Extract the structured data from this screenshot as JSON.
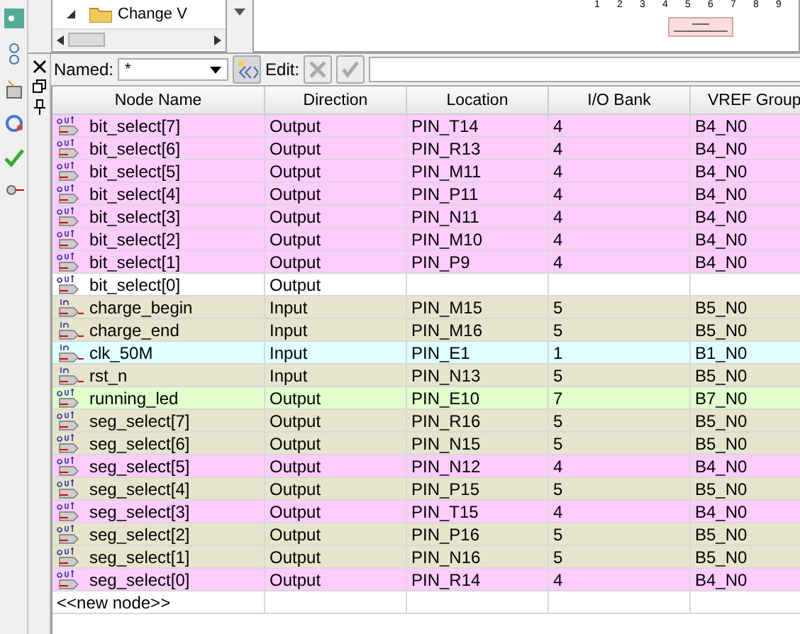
{
  "tree": {
    "item": "Change V"
  },
  "timeline": {
    "ticks": [
      "1",
      "2",
      "3",
      "4",
      "5",
      "6",
      "7",
      "8",
      "9"
    ]
  },
  "filter_bar": {
    "named_label": "Named:",
    "named_value": "*",
    "edit_label": "Edit:"
  },
  "table": {
    "columns": [
      "Node Name",
      "Direction",
      "Location",
      "I/O Bank",
      "VREF Group"
    ],
    "rows": [
      {
        "kind": "out",
        "name": "bit_select[7]",
        "direction": "Output",
        "location": "PIN_T14",
        "bank": "4",
        "vref": "B4_N0",
        "color": "#ffccff"
      },
      {
        "kind": "out",
        "name": "bit_select[6]",
        "direction": "Output",
        "location": "PIN_R13",
        "bank": "4",
        "vref": "B4_N0",
        "color": "#ffccff"
      },
      {
        "kind": "out",
        "name": "bit_select[5]",
        "direction": "Output",
        "location": "PIN_M11",
        "bank": "4",
        "vref": "B4_N0",
        "color": "#ffccff"
      },
      {
        "kind": "out",
        "name": "bit_select[4]",
        "direction": "Output",
        "location": "PIN_P11",
        "bank": "4",
        "vref": "B4_N0",
        "color": "#ffccff"
      },
      {
        "kind": "out",
        "name": "bit_select[3]",
        "direction": "Output",
        "location": "PIN_N11",
        "bank": "4",
        "vref": "B4_N0",
        "color": "#ffccff"
      },
      {
        "kind": "out",
        "name": "bit_select[2]",
        "direction": "Output",
        "location": "PIN_M10",
        "bank": "4",
        "vref": "B4_N0",
        "color": "#ffccff"
      },
      {
        "kind": "out",
        "name": "bit_select[1]",
        "direction": "Output",
        "location": "PIN_P9",
        "bank": "4",
        "vref": "B4_N0",
        "color": "#ffccff"
      },
      {
        "kind": "out",
        "name": "bit_select[0]",
        "direction": "Output",
        "color": "#ffffff"
      },
      {
        "kind": "in",
        "name": "charge_begin",
        "direction": "Input",
        "location": "PIN_M15",
        "bank": "5",
        "vref": "B5_N0",
        "color": "#e6e4cc"
      },
      {
        "kind": "in",
        "name": "charge_end",
        "direction": "Input",
        "location": "PIN_M16",
        "bank": "5",
        "vref": "B5_N0",
        "color": "#e6e4cc"
      },
      {
        "kind": "in",
        "name": "clk_50M",
        "direction": "Input",
        "location": "PIN_E1",
        "bank": "1",
        "vref": "B1_N0",
        "color": "#e0ffff"
      },
      {
        "kind": "in",
        "name": "rst_n",
        "direction": "Input",
        "location": "PIN_N13",
        "bank": "5",
        "vref": "B5_N0",
        "color": "#e6e4cc"
      },
      {
        "kind": "out",
        "name": "running_led",
        "direction": "Output",
        "location": "PIN_E10",
        "bank": "7",
        "vref": "B7_N0",
        "color": "#e0ffcc"
      },
      {
        "kind": "out",
        "name": "seg_select[7]",
        "direction": "Output",
        "location": "PIN_R16",
        "bank": "5",
        "vref": "B5_N0",
        "color": "#e6e4cc"
      },
      {
        "kind": "out",
        "name": "seg_select[6]",
        "direction": "Output",
        "location": "PIN_N15",
        "bank": "5",
        "vref": "B5_N0",
        "color": "#e6e4cc"
      },
      {
        "kind": "out",
        "name": "seg_select[5]",
        "direction": "Output",
        "location": "PIN_N12",
        "bank": "4",
        "vref": "B4_N0",
        "color": "#ffccff"
      },
      {
        "kind": "out",
        "name": "seg_select[4]",
        "direction": "Output",
        "location": "PIN_P15",
        "bank": "5",
        "vref": "B5_N0",
        "color": "#e6e4cc"
      },
      {
        "kind": "out",
        "name": "seg_select[3]",
        "direction": "Output",
        "location": "PIN_T15",
        "bank": "4",
        "vref": "B4_N0",
        "color": "#ffccff"
      },
      {
        "kind": "out",
        "name": "seg_select[2]",
        "direction": "Output",
        "location": "PIN_P16",
        "bank": "5",
        "vref": "B5_N0",
        "color": "#e6e4cc"
      },
      {
        "kind": "out",
        "name": "seg_select[1]",
        "direction": "Output",
        "location": "PIN_N16",
        "bank": "5",
        "vref": "B5_N0",
        "color": "#e6e4cc"
      },
      {
        "kind": "out",
        "name": "seg_select[0]",
        "direction": "Output",
        "location": "PIN_R14",
        "bank": "4",
        "vref": "B4_N0",
        "color": "#ffccff"
      }
    ],
    "new_node": "<<new node>>"
  }
}
